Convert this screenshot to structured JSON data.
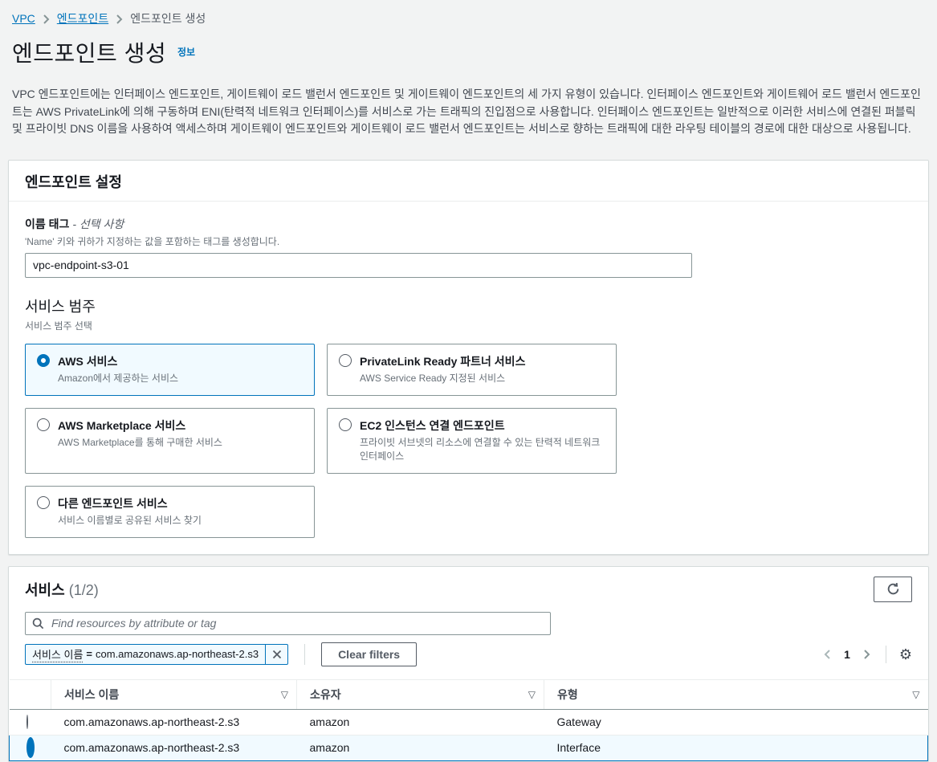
{
  "breadcrumb": {
    "vpc": "VPC",
    "endpoints": "엔드포인트",
    "current": "엔드포인트 생성"
  },
  "header": {
    "title": "엔드포인트 생성",
    "info_label": "정보",
    "description": "VPC 엔드포인트에는 인터페이스 엔드포인트, 게이트웨이 로드 밸런서 엔드포인트 및 게이트웨이 엔드포인트의 세 가지 유형이 있습니다. 인터페이스 엔드포인트와 게이트웨어 로드 밸런서 엔드포인트는 AWS PrivateLink에 의해 구동하며 ENI(탄력적 네트워크 인터페이스)를 서비스로 가는 트래픽의 진입점으로 사용합니다. 인터페이스 엔드포인트는 일반적으로 이러한 서비스에 연결된 퍼블릭 및 프라이빗 DNS 이름을 사용하여 액세스하며 게이트웨이 엔드포인트와 게이트웨이 로드 밸런서 엔드포인트는 서비스로 향하는 트래픽에 대한 라우팅 테이블의 경로에 대한 대상으로 사용됩니다."
  },
  "endpoint_settings": {
    "section_title": "엔드포인트 설정",
    "name_tag": {
      "label": "이름 태그",
      "optional_label": "- 선택 사항",
      "description": "'Name' 키와 귀하가 지정하는 값을 포함하는 태그를 생성합니다.",
      "value": "vpc-endpoint-s3-01"
    },
    "service_category": {
      "label": "서비스 범주",
      "description": "서비스 범주 선택",
      "options": [
        {
          "title": "AWS 서비스",
          "description": "Amazon에서 제공하는 서비스",
          "selected": true
        },
        {
          "title": "PrivateLink Ready 파트너 서비스",
          "description": "AWS Service Ready 지정된 서비스",
          "selected": false
        },
        {
          "title": "AWS Marketplace 서비스",
          "description": "AWS Marketplace를 통해 구매한 서비스",
          "selected": false
        },
        {
          "title": "EC2 인스턴스 연결 엔드포인트",
          "description": "프라이빗 서브넷의 리소스에 연결할 수 있는 탄력적 네트워크 인터페이스",
          "selected": false
        },
        {
          "title": "다른 엔드포인트 서비스",
          "description": "서비스 이름별로 공유된 서비스 찾기",
          "selected": false
        }
      ]
    }
  },
  "services": {
    "section_title": "서비스",
    "count": "(1/2)",
    "search_placeholder": "Find resources by attribute or tag",
    "filter_tag": {
      "key": "서비스 이름",
      "operator": "=",
      "value": "com.amazonaws.ap-northeast-2.s3"
    },
    "clear_filters_label": "Clear filters",
    "pagination": {
      "page": "1"
    },
    "table": {
      "columns": {
        "service_name": "서비스 이름",
        "owner": "소유자",
        "type": "유형"
      },
      "rows": [
        {
          "service_name": "com.amazonaws.ap-northeast-2.s3",
          "owner": "amazon",
          "type": "Gateway",
          "selected": false
        },
        {
          "service_name": "com.amazonaws.ap-northeast-2.s3",
          "owner": "amazon",
          "type": "Interface",
          "selected": true
        }
      ]
    }
  },
  "colors": {
    "accent_blue": "#0073bb",
    "selected_bg": "#f1faff",
    "page_bg": "#f2f3f3",
    "border_gray": "#879596",
    "text_muted": "#687078"
  }
}
